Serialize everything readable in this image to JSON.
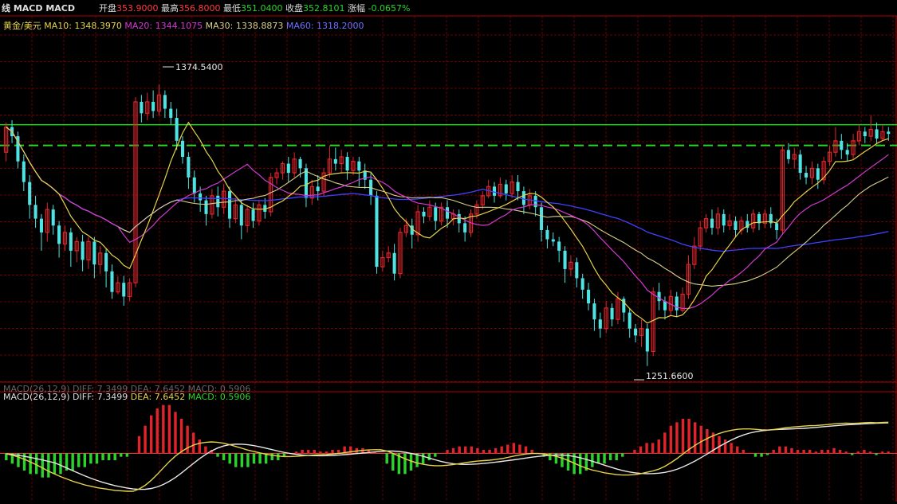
{
  "header": {
    "title": "线 MACD MACD",
    "open_label": "开盘",
    "open_value": "353.9000",
    "high_label": "最高",
    "high_value": "356.8000",
    "low_label": "最低",
    "low_value": "351.0400",
    "close_label": "收盘",
    "close_value": "352.8101",
    "change_label": "涨幅",
    "change_value": "-0.0657%"
  },
  "ma_legend": {
    "symbol": "黄金/美元",
    "ma10": "MA10: 1348.3970",
    "ma20": "MA20: 1344.1075",
    "ma30": "MA30: 1338.8873",
    "ma60": "MA60: 1318.2000"
  },
  "macd_legend": {
    "ghost": "MACD(26,12,9) DIFF: 7.3499 DEA: 7.6452 MACD: 0.5906",
    "label": "MACD(26,12,9)",
    "diff": "DIFF: 7.3499",
    "dea": "DEA: 7.6452",
    "macd": "MACD: 0.5906"
  },
  "annotations": {
    "high": "1374.5400",
    "low": "1251.6600"
  },
  "colors": {
    "up": "#e0242b",
    "down": "#4fe3e3",
    "grid": "#6e0000",
    "ma10": "#e6d34a",
    "ma20": "#d13ad1",
    "ma30": "#d8cf8a",
    "ma60": "#4040ff",
    "support": "#2bd42b",
    "diff": "#e8e8e8",
    "dea": "#e6d34a"
  },
  "chart_data": {
    "type": "candlestick",
    "price_range": [
      1246,
      1392
    ],
    "support_levels": [
      1357,
      1348
    ],
    "candles": [
      [
        1345,
        1356,
        1341,
        1358
      ],
      [
        1356,
        1352,
        1349,
        1359
      ],
      [
        1352,
        1341,
        1338,
        1354
      ],
      [
        1341,
        1332,
        1328,
        1344
      ],
      [
        1332,
        1322,
        1316,
        1335
      ],
      [
        1322,
        1316,
        1312,
        1326
      ],
      [
        1316,
        1310,
        1302,
        1318
      ],
      [
        1310,
        1320,
        1306,
        1323
      ],
      [
        1320,
        1313,
        1309,
        1322
      ],
      [
        1313,
        1305,
        1299,
        1315
      ],
      [
        1305,
        1310,
        1302,
        1313
      ],
      [
        1310,
        1302,
        1295,
        1312
      ],
      [
        1302,
        1306,
        1297,
        1308
      ],
      [
        1306,
        1298,
        1293,
        1309
      ],
      [
        1298,
        1306,
        1294,
        1308
      ],
      [
        1306,
        1296,
        1290,
        1308
      ],
      [
        1296,
        1301,
        1292,
        1304
      ],
      [
        1301,
        1293,
        1286,
        1303
      ],
      [
        1293,
        1284,
        1281,
        1296
      ],
      [
        1284,
        1288,
        1283,
        1291
      ],
      [
        1288,
        1282,
        1278,
        1291
      ],
      [
        1282,
        1288,
        1280,
        1290
      ],
      [
        1288,
        1367,
        1286,
        1369
      ],
      [
        1367,
        1362,
        1358,
        1370
      ],
      [
        1362,
        1367,
        1359,
        1371
      ],
      [
        1367,
        1363,
        1360,
        1372
      ],
      [
        1363,
        1370,
        1361,
        1374.54
      ],
      [
        1370,
        1364,
        1360,
        1372
      ],
      [
        1364,
        1360,
        1357,
        1367
      ],
      [
        1360,
        1350,
        1346,
        1364
      ],
      [
        1350,
        1343,
        1340,
        1352
      ],
      [
        1343,
        1334,
        1329,
        1345
      ],
      [
        1334,
        1327,
        1323,
        1337
      ],
      [
        1327,
        1324,
        1319,
        1330
      ],
      [
        1324,
        1318,
        1313,
        1326
      ],
      [
        1318,
        1326,
        1316,
        1329
      ],
      [
        1326,
        1321,
        1317,
        1330
      ],
      [
        1321,
        1328,
        1318,
        1331
      ],
      [
        1328,
        1316,
        1312,
        1330
      ],
      [
        1316,
        1322,
        1314,
        1325
      ],
      [
        1322,
        1313,
        1307,
        1324
      ],
      [
        1313,
        1320,
        1310,
        1322
      ],
      [
        1320,
        1315,
        1312,
        1323
      ],
      [
        1315,
        1322,
        1313,
        1324
      ],
      [
        1322,
        1319,
        1316,
        1325
      ],
      [
        1319,
        1334,
        1317,
        1336
      ],
      [
        1334,
        1336,
        1331,
        1338
      ],
      [
        1336,
        1340,
        1333,
        1341
      ],
      [
        1340,
        1336,
        1332,
        1343
      ],
      [
        1336,
        1342,
        1334,
        1345
      ],
      [
        1342,
        1338,
        1334,
        1343
      ],
      [
        1338,
        1325,
        1321,
        1340
      ],
      [
        1325,
        1330,
        1322,
        1333
      ],
      [
        1330,
        1328,
        1324,
        1335
      ],
      [
        1328,
        1336,
        1326,
        1338
      ],
      [
        1336,
        1342,
        1334,
        1348
      ],
      [
        1342,
        1340,
        1337,
        1347
      ],
      [
        1340,
        1343,
        1336,
        1346
      ],
      [
        1343,
        1337,
        1333,
        1345
      ],
      [
        1337,
        1341,
        1335,
        1343
      ],
      [
        1341,
        1337,
        1330,
        1343
      ],
      [
        1337,
        1333,
        1329,
        1340
      ],
      [
        1333,
        1326,
        1322,
        1336
      ],
      [
        1326,
        1295,
        1292,
        1328
      ],
      [
        1295,
        1299,
        1293,
        1302
      ],
      [
        1299,
        1301,
        1297,
        1304
      ],
      [
        1301,
        1292,
        1289,
        1305
      ],
      [
        1292,
        1310,
        1290,
        1312
      ],
      [
        1310,
        1313,
        1308,
        1316
      ],
      [
        1313,
        1309,
        1303,
        1316
      ],
      [
        1309,
        1319,
        1306,
        1322
      ],
      [
        1319,
        1317,
        1314,
        1321
      ],
      [
        1317,
        1321,
        1315,
        1324
      ],
      [
        1321,
        1315,
        1311,
        1323
      ],
      [
        1315,
        1321,
        1313,
        1323
      ],
      [
        1321,
        1316,
        1312,
        1324
      ],
      [
        1316,
        1318,
        1313,
        1320
      ],
      [
        1318,
        1314,
        1310,
        1320
      ],
      [
        1314,
        1310,
        1306,
        1317
      ],
      [
        1310,
        1318,
        1308,
        1320
      ],
      [
        1318,
        1322,
        1316,
        1324
      ],
      [
        1322,
        1326,
        1320,
        1328
      ],
      [
        1326,
        1330,
        1325,
        1333
      ],
      [
        1330,
        1326,
        1323,
        1332
      ],
      [
        1326,
        1331,
        1325,
        1334
      ],
      [
        1331,
        1327,
        1324,
        1333
      ],
      [
        1327,
        1332,
        1325,
        1335
      ],
      [
        1332,
        1328,
        1324,
        1335
      ],
      [
        1328,
        1322,
        1318,
        1330
      ],
      [
        1322,
        1326,
        1320,
        1329
      ],
      [
        1326,
        1321,
        1317,
        1328
      ],
      [
        1321,
        1311,
        1306,
        1323
      ],
      [
        1311,
        1307,
        1303,
        1313
      ],
      [
        1307,
        1306,
        1304,
        1310
      ],
      [
        1306,
        1302,
        1297,
        1308
      ],
      [
        1302,
        1294,
        1288,
        1304
      ],
      [
        1294,
        1297,
        1291,
        1300
      ],
      [
        1297,
        1290,
        1286,
        1299
      ],
      [
        1290,
        1285,
        1281,
        1292
      ],
      [
        1285,
        1279,
        1276,
        1288
      ],
      [
        1279,
        1272,
        1267,
        1281
      ],
      [
        1272,
        1268,
        1264,
        1275
      ],
      [
        1268,
        1277,
        1266,
        1280
      ],
      [
        1277,
        1272,
        1269,
        1279
      ],
      [
        1272,
        1281,
        1270,
        1284
      ],
      [
        1281,
        1275,
        1271,
        1282
      ],
      [
        1275,
        1268,
        1264,
        1277
      ],
      [
        1268,
        1265,
        1262,
        1270
      ],
      [
        1265,
        1268,
        1260,
        1272
      ],
      [
        1268,
        1258,
        1251.66,
        1270
      ],
      [
        1258,
        1284,
        1256,
        1286
      ],
      [
        1284,
        1280,
        1276,
        1288
      ],
      [
        1280,
        1276,
        1272,
        1282
      ],
      [
        1276,
        1282,
        1274,
        1285
      ],
      [
        1282,
        1276,
        1273,
        1284
      ],
      [
        1276,
        1283,
        1275,
        1286
      ],
      [
        1283,
        1296,
        1281,
        1300
      ],
      [
        1296,
        1304,
        1294,
        1308
      ],
      [
        1304,
        1312,
        1302,
        1315
      ],
      [
        1312,
        1316,
        1310,
        1318
      ],
      [
        1316,
        1312,
        1309,
        1320
      ],
      [
        1312,
        1318,
        1309,
        1321
      ],
      [
        1318,
        1313,
        1310,
        1320
      ],
      [
        1313,
        1315,
        1311,
        1318
      ],
      [
        1315,
        1311,
        1308,
        1317
      ],
      [
        1311,
        1315,
        1309,
        1317
      ],
      [
        1315,
        1312,
        1310,
        1318
      ],
      [
        1312,
        1318,
        1310,
        1320
      ],
      [
        1318,
        1314,
        1311,
        1319
      ],
      [
        1314,
        1318,
        1312,
        1320
      ],
      [
        1318,
        1314,
        1312,
        1321
      ],
      [
        1314,
        1311,
        1307,
        1316
      ],
      [
        1311,
        1346,
        1309,
        1348
      ],
      [
        1346,
        1342,
        1340,
        1349
      ],
      [
        1342,
        1344,
        1338,
        1347
      ],
      [
        1344,
        1336,
        1333,
        1346
      ],
      [
        1336,
        1334,
        1331,
        1339
      ],
      [
        1334,
        1338,
        1331,
        1341
      ],
      [
        1338,
        1333,
        1329,
        1340
      ],
      [
        1333,
        1341,
        1331,
        1343
      ],
      [
        1341,
        1345,
        1339,
        1348
      ],
      [
        1345,
        1350,
        1343,
        1356
      ],
      [
        1350,
        1346,
        1342,
        1353
      ],
      [
        1346,
        1344,
        1341,
        1349
      ],
      [
        1344,
        1350,
        1342,
        1353
      ],
      [
        1350,
        1354,
        1348,
        1357
      ],
      [
        1354,
        1352,
        1349,
        1356
      ],
      [
        1352,
        1355,
        1350,
        1361
      ],
      [
        1355,
        1351,
        1349,
        1358
      ],
      [
        1351,
        1354,
        1350,
        1357
      ],
      [
        1354,
        1353,
        1350,
        1356
      ]
    ],
    "macd_range": [
      -14,
      16
    ],
    "macd_hist": [
      -2,
      -3,
      -4,
      -5,
      -6,
      -6,
      -7,
      -7,
      -6,
      -6,
      -5,
      -5,
      -4,
      -4,
      -3,
      -3,
      -2,
      -2,
      -2,
      -1,
      -1,
      0,
      5,
      8,
      11,
      13,
      14,
      14,
      12,
      10,
      8,
      6,
      4,
      2,
      1,
      -1,
      -2,
      -3,
      -4,
      -4,
      -4,
      -3,
      -3,
      -3,
      -2,
      -2,
      -1,
      0,
      0.5,
      1,
      1,
      1,
      0.5,
      0.5,
      1,
      1,
      2,
      2,
      1.5,
      1.5,
      1,
      0.5,
      0,
      -3,
      -5,
      -6,
      -6,
      -5,
      -4,
      -3,
      -2,
      -1,
      0,
      1,
      1.5,
      2,
      2,
      2,
      1.5,
      1,
      1,
      1.5,
      2,
      2.5,
      3,
      2.5,
      2,
      1,
      0,
      -1,
      -2,
      -3,
      -4,
      -5,
      -6,
      -6,
      -5,
      -4,
      -3,
      -3,
      -2,
      -2,
      -1,
      0,
      1,
      2,
      3,
      3,
      4,
      6,
      8,
      9,
      10,
      10,
      9,
      8,
      7,
      6,
      5,
      4,
      3,
      2,
      1,
      0,
      -1,
      -1,
      -0.5,
      1,
      2,
      2,
      1.5,
      1,
      1,
      1,
      0.5,
      1,
      1,
      1.5,
      1,
      0.5,
      -0.5,
      0.5,
      1,
      0.5,
      -0.5,
      0.5,
      0.5
    ]
  }
}
